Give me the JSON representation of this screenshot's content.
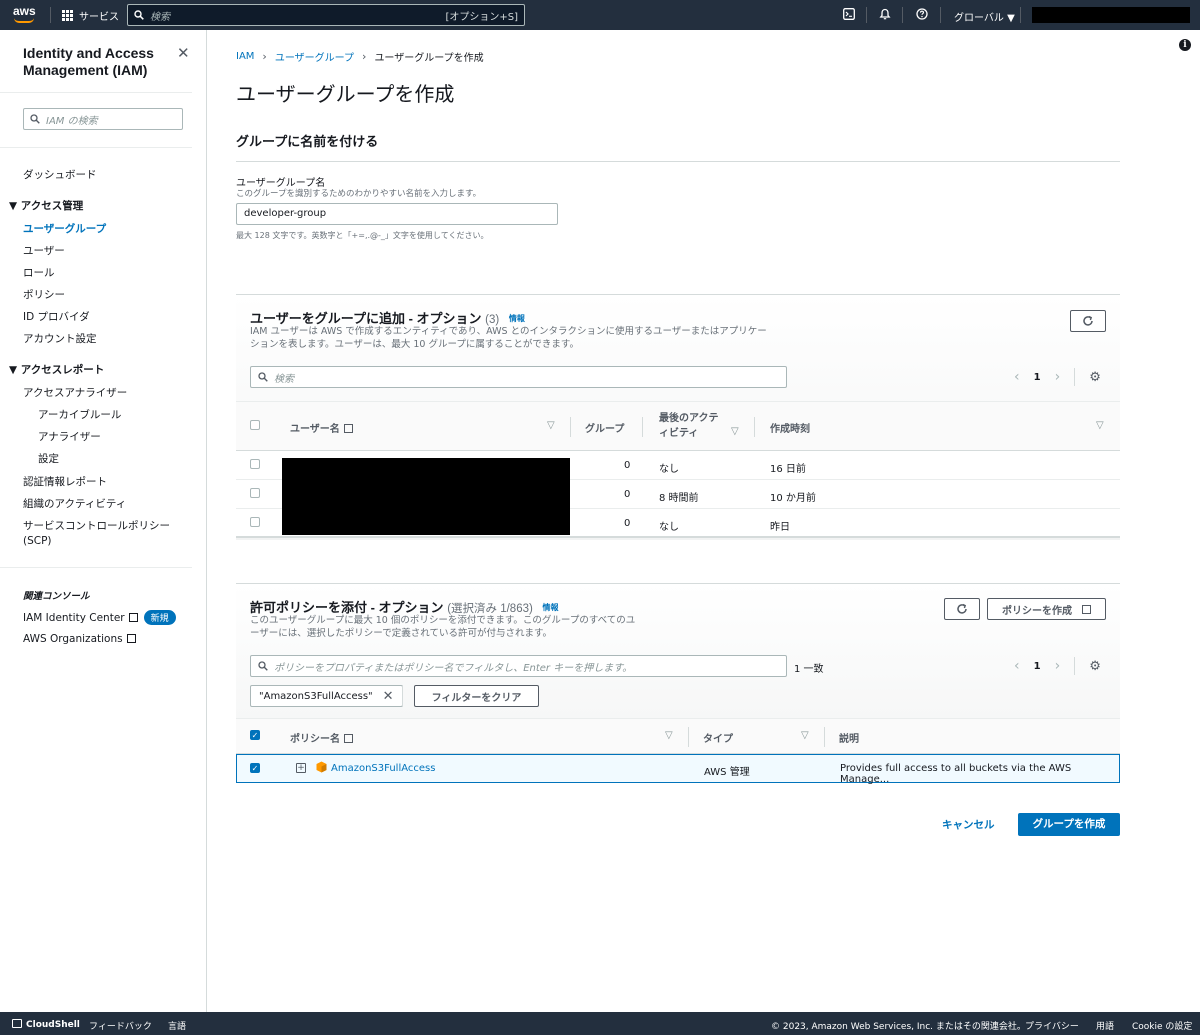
{
  "topbar": {
    "logo": "aws",
    "services": "サービス",
    "search_placeholder": "検索",
    "search_shortcut": "[オプション+S]",
    "region": "グローバル ▼"
  },
  "sidebar": {
    "title": "Identity and Access Management (IAM)",
    "search_placeholder": "IAM の検索",
    "dashboard": "ダッシュボード",
    "access_mgmt": "アクセス管理",
    "access_items": [
      "ユーザーグループ",
      "ユーザー",
      "ロール",
      "ポリシー",
      "ID プロバイダ",
      "アカウント設定"
    ],
    "access_reports": "アクセスレポート",
    "analyzer": "アクセスアナライザー",
    "analyzer_sub": [
      "アーカイブルール",
      "アナライザー",
      "設定"
    ],
    "report_items": [
      "認証情報レポート",
      "組織のアクティビティ",
      "サービスコントロールポリシー",
      "(SCP)"
    ],
    "related_title": "関連コンソール",
    "identity_center": "IAM Identity Center",
    "new_badge": "新規",
    "organizations": "AWS Organizations"
  },
  "breadcrumb": [
    "IAM",
    "ユーザーグループ",
    "ユーザーグループを作成"
  ],
  "page_title": "ユーザーグループを作成",
  "name_section": {
    "title": "グループに名前を付ける",
    "label": "ユーザーグループ名",
    "description": "このグループを識別するためのわかりやすい名前を入力します。",
    "value": "developer-group",
    "hint": "最大 128 文字です。英数字と「+=,.@-_」文字を使用してください。"
  },
  "users_section": {
    "title": "ユーザーをグループに追加 - オプション",
    "count": "(3)",
    "info": "情報",
    "desc_line1": "IAM ユーザーは AWS で作成するエンティティであり、AWS とのインタラクションに使用するユーザーまたはアプリケー",
    "desc_line2": "ションを表します。ユーザーは、最大 10 グループに属することができます。",
    "search_placeholder": "検索",
    "page": "1",
    "columns": [
      "ユーザー名",
      "グループ",
      "最後のアクテ",
      "ィビティ",
      "作成時刻"
    ],
    "rows": [
      {
        "groups": "0",
        "last_activity": "なし",
        "created": "16 日前"
      },
      {
        "groups": "0",
        "last_activity": "8 時間前",
        "created": "10 か月前"
      },
      {
        "groups": "0",
        "last_activity": "なし",
        "created": "昨日"
      }
    ]
  },
  "policy_section": {
    "title": "許可ポリシーを添付 - オプション",
    "count": "(選択済み 1/863)",
    "info": "情報",
    "desc_line1": "このユーザーグループに最大 10 個のポリシーを添付できます。このグループのすべてのユ",
    "desc_line2": "ーザーには、選択したポリシーで定義されている許可が付与されます。",
    "create_policy": "ポリシーを作成",
    "search_placeholder": "ポリシーをプロパティまたはポリシー名でフィルタし、Enter キーを押します。",
    "match_count": "1 一致",
    "page": "1",
    "filter_token": "\"AmazonS3FullAccess\"",
    "clear_filters": "フィルターをクリア",
    "columns": [
      "ポリシー名",
      "タイプ",
      "説明"
    ],
    "rows": [
      {
        "name": "AmazonS3FullAccess",
        "type": "AWS 管理",
        "description": "Provides full access to all buckets via the AWS Manage..."
      }
    ]
  },
  "actions": {
    "cancel": "キャンセル",
    "create": "グループを作成"
  },
  "footer": {
    "cloudshell": "CloudShell",
    "feedback": "フィードバック",
    "language": "言語",
    "copyright": "© 2023, Amazon Web Services, Inc. またはその関連会社。",
    "privacy": "プライバシー",
    "terms": "用語",
    "cookie": "Cookie の設定"
  },
  "colors": {
    "nav_bg": "#232f3e",
    "accent": "#0073bb",
    "orange": "#ff9900"
  }
}
